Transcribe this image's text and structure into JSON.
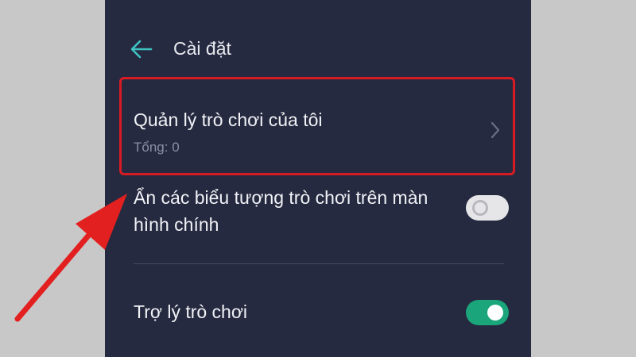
{
  "header": {
    "title": "Cài đặt",
    "back_icon": "arrow-left-icon",
    "back_color": "#3fc3c2"
  },
  "settings": {
    "manage_games": {
      "label": "Quản lý trò chơi của tôi",
      "subtitle": "Tổng: 0",
      "icon": "chevron-right-icon"
    },
    "hide_icons": {
      "label": "Ẩn các biểu tượng trò chơi trên màn hình chính",
      "enabled": false
    },
    "game_assistant": {
      "label": "Trợ lý trò chơi",
      "enabled": true
    }
  },
  "annotation": {
    "highlight_color": "#d81b22",
    "arrow_color": "#e32020"
  }
}
